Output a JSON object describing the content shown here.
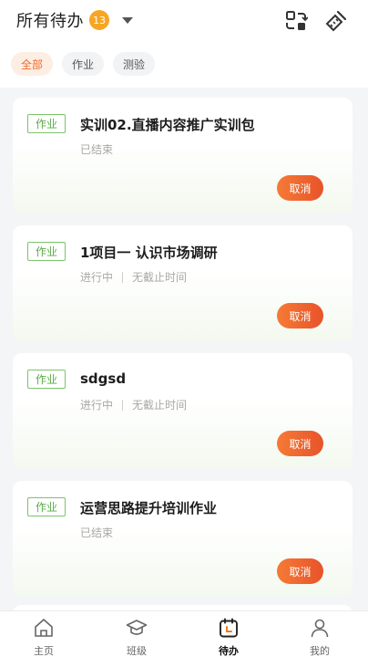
{
  "header": {
    "title": "所有待办",
    "count": "13",
    "dropdown_icon": "chevron-down-icon",
    "icons": [
      "switch-icon",
      "clean-icon"
    ]
  },
  "filters": [
    {
      "label": "全部",
      "active": true
    },
    {
      "label": "作业",
      "active": false
    },
    {
      "label": "测验",
      "active": false
    }
  ],
  "cards": [
    {
      "tag": "作业",
      "title": "实训02.直播内容推广实训包",
      "status": "已结束",
      "deadline": "",
      "action": "取消"
    },
    {
      "tag": "作业",
      "title": "1项目一 认识市场调研",
      "status": "进行中",
      "deadline": "无截止时间",
      "action": "取消"
    },
    {
      "tag": "作业",
      "title": "sdgsd",
      "status": "进行中",
      "deadline": "无截止时间",
      "action": "取消"
    },
    {
      "tag": "作业",
      "title": "运营思路提升培训作业",
      "status": "已结束",
      "deadline": "",
      "action": "取消"
    }
  ],
  "tabbar": [
    {
      "label": "主页",
      "icon": "home-icon",
      "active": false
    },
    {
      "label": "班级",
      "icon": "class-icon",
      "active": false
    },
    {
      "label": "待办",
      "icon": "todo-icon",
      "active": true
    },
    {
      "label": "我的",
      "icon": "profile-icon",
      "active": false
    }
  ],
  "colors": {
    "accent": "#ef6a2c",
    "badge": "#f6a623",
    "tag_green": "#5aaa47",
    "page_bg": "#f4f5f7"
  }
}
